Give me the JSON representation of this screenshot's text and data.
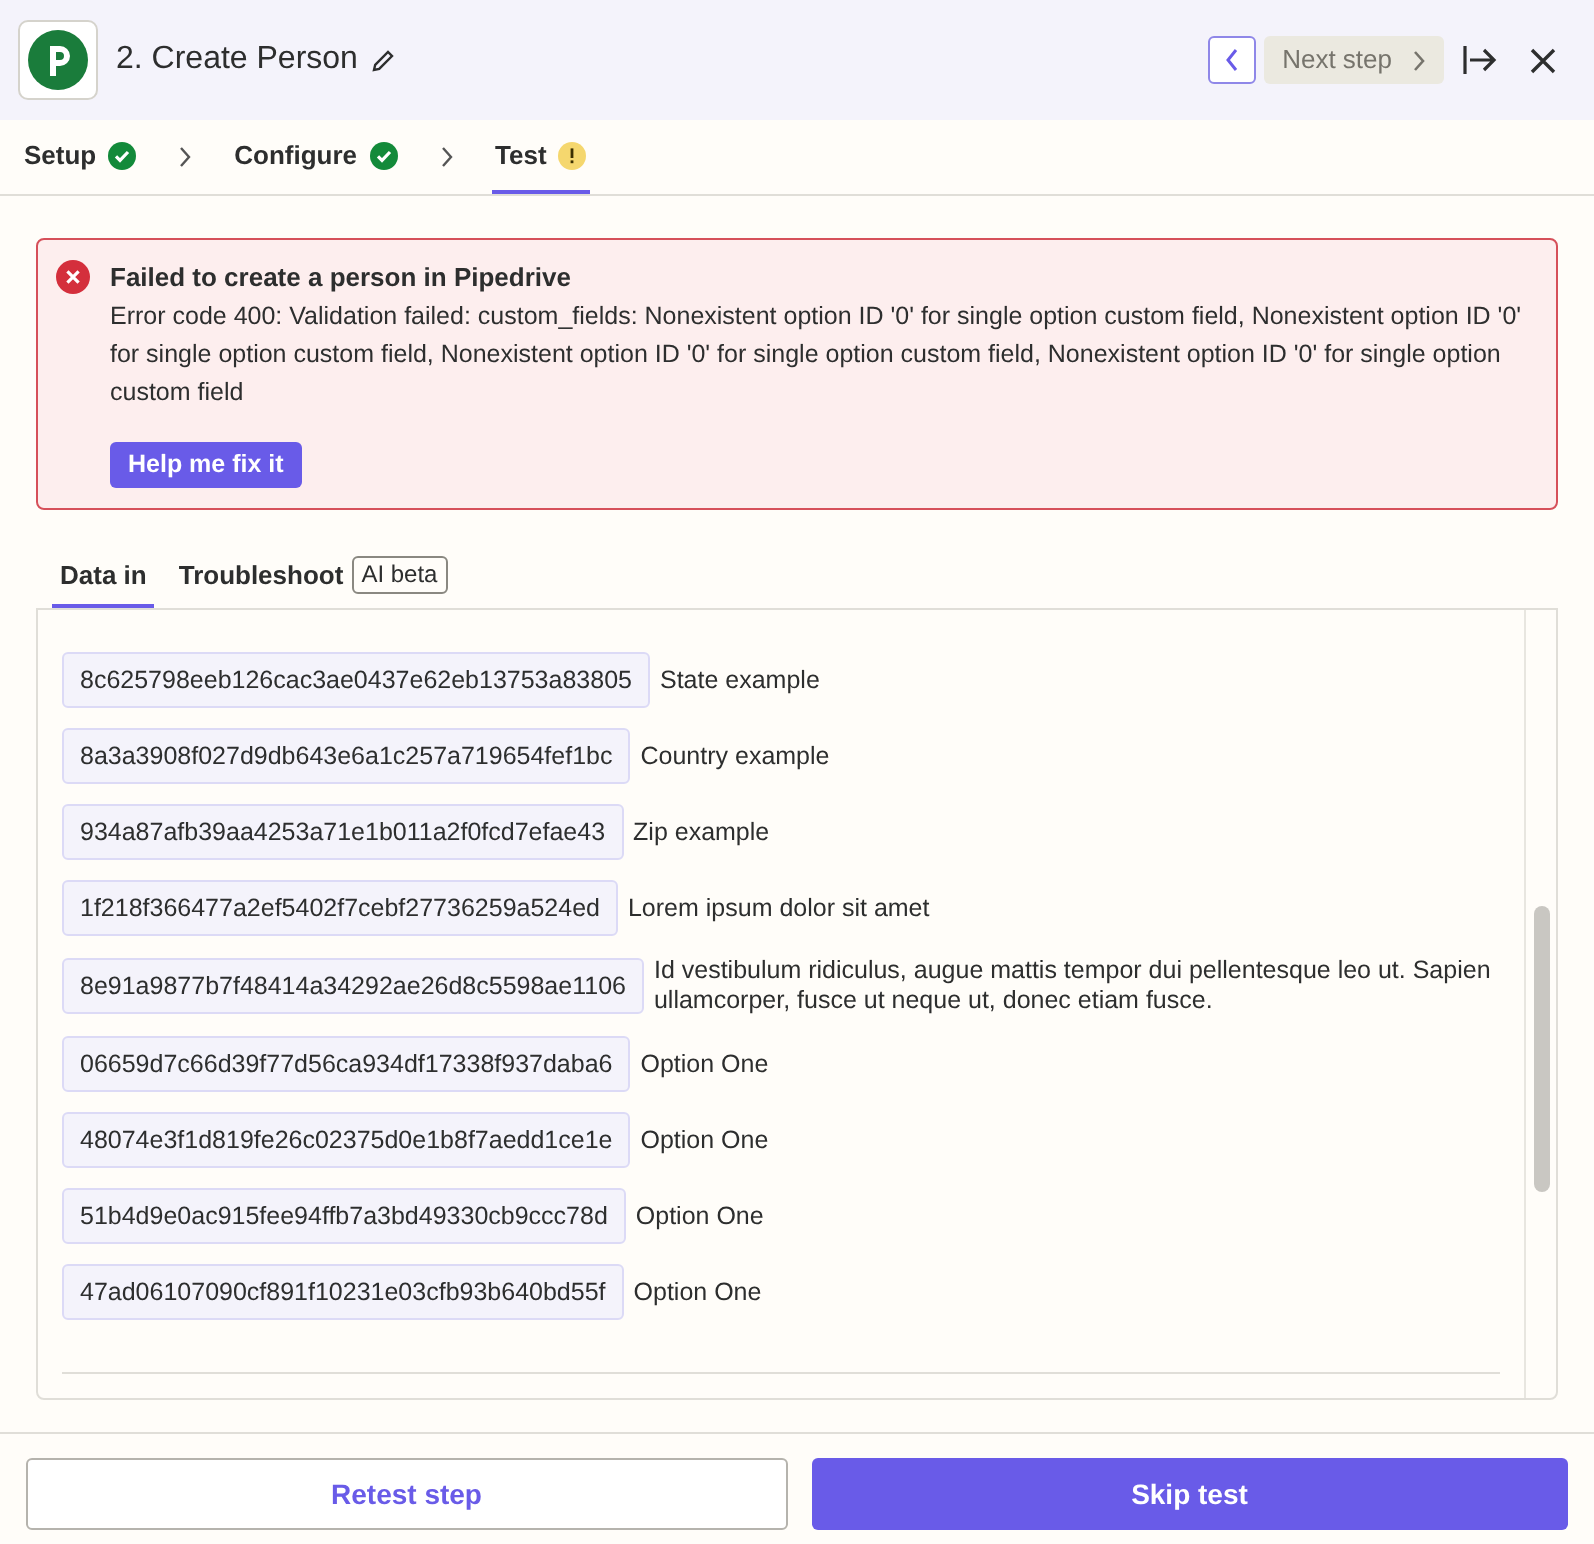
{
  "header": {
    "title": "2. Create Person",
    "next_step": {
      "label": "Next step",
      "disabled": true
    }
  },
  "steps": [
    {
      "label": "Setup",
      "kind": "done",
      "selected": false
    },
    {
      "label": "Configure",
      "kind": "done",
      "selected": false
    },
    {
      "label": "Test",
      "kind": "warning",
      "selected": true
    }
  ],
  "error": {
    "title": "Failed to create a person in Pipedrive",
    "message": "Error code 400: Validation failed: custom_fields: Nonexistent option ID '0' for single option custom field, Nonexistent option ID '0' for single option custom field, Nonexistent option ID '0' for single option custom field, Nonexistent option ID '0' for single option custom field",
    "button": "Help me fix it"
  },
  "tabs": [
    {
      "label": "Data in",
      "selected": true
    },
    {
      "label": "Troubleshoot",
      "badge": "AI beta",
      "selected": false
    }
  ],
  "fields": [
    {
      "key": "8c625798eeb126cac3ae0437e62eb13753a83805",
      "value": "State example"
    },
    {
      "key": "8a3a3908f027d9db643e6a1c257a719654fef1bc",
      "value": "Country example"
    },
    {
      "key": "934a87afb39aa4253a71e1b011a2f0fcd7efae43",
      "value": "Zip example"
    },
    {
      "key": "1f218f366477a2ef5402f7cebf27736259a524ed",
      "value": "Lorem ipsum dolor sit amet"
    },
    {
      "key": "8e91a9877b7f48414a34292ae26d8c5598ae1106",
      "value": "Id vestibulum ridiculus, augue mattis tempor dui pellentesque leo ut. Sapien ullamcorper, fusce ut neque ut, donec etiam fusce."
    },
    {
      "key": "06659d7c66d39f77d56ca934df17338f937daba6",
      "value": "Option One"
    },
    {
      "key": "48074e3f1d819fe26c02375d0e1b8f7aedd1ce1e",
      "value": "Option One"
    },
    {
      "key": "51b4d9e0ac915fee94ffb7a3bd49330cb9ccc78d",
      "value": "Option One"
    },
    {
      "key": "47ad06107090cf891f10231e03cfb93b640bd55f",
      "value": "Option One"
    }
  ],
  "footer": {
    "secondary": "Retest step",
    "primary": "Skip test"
  }
}
